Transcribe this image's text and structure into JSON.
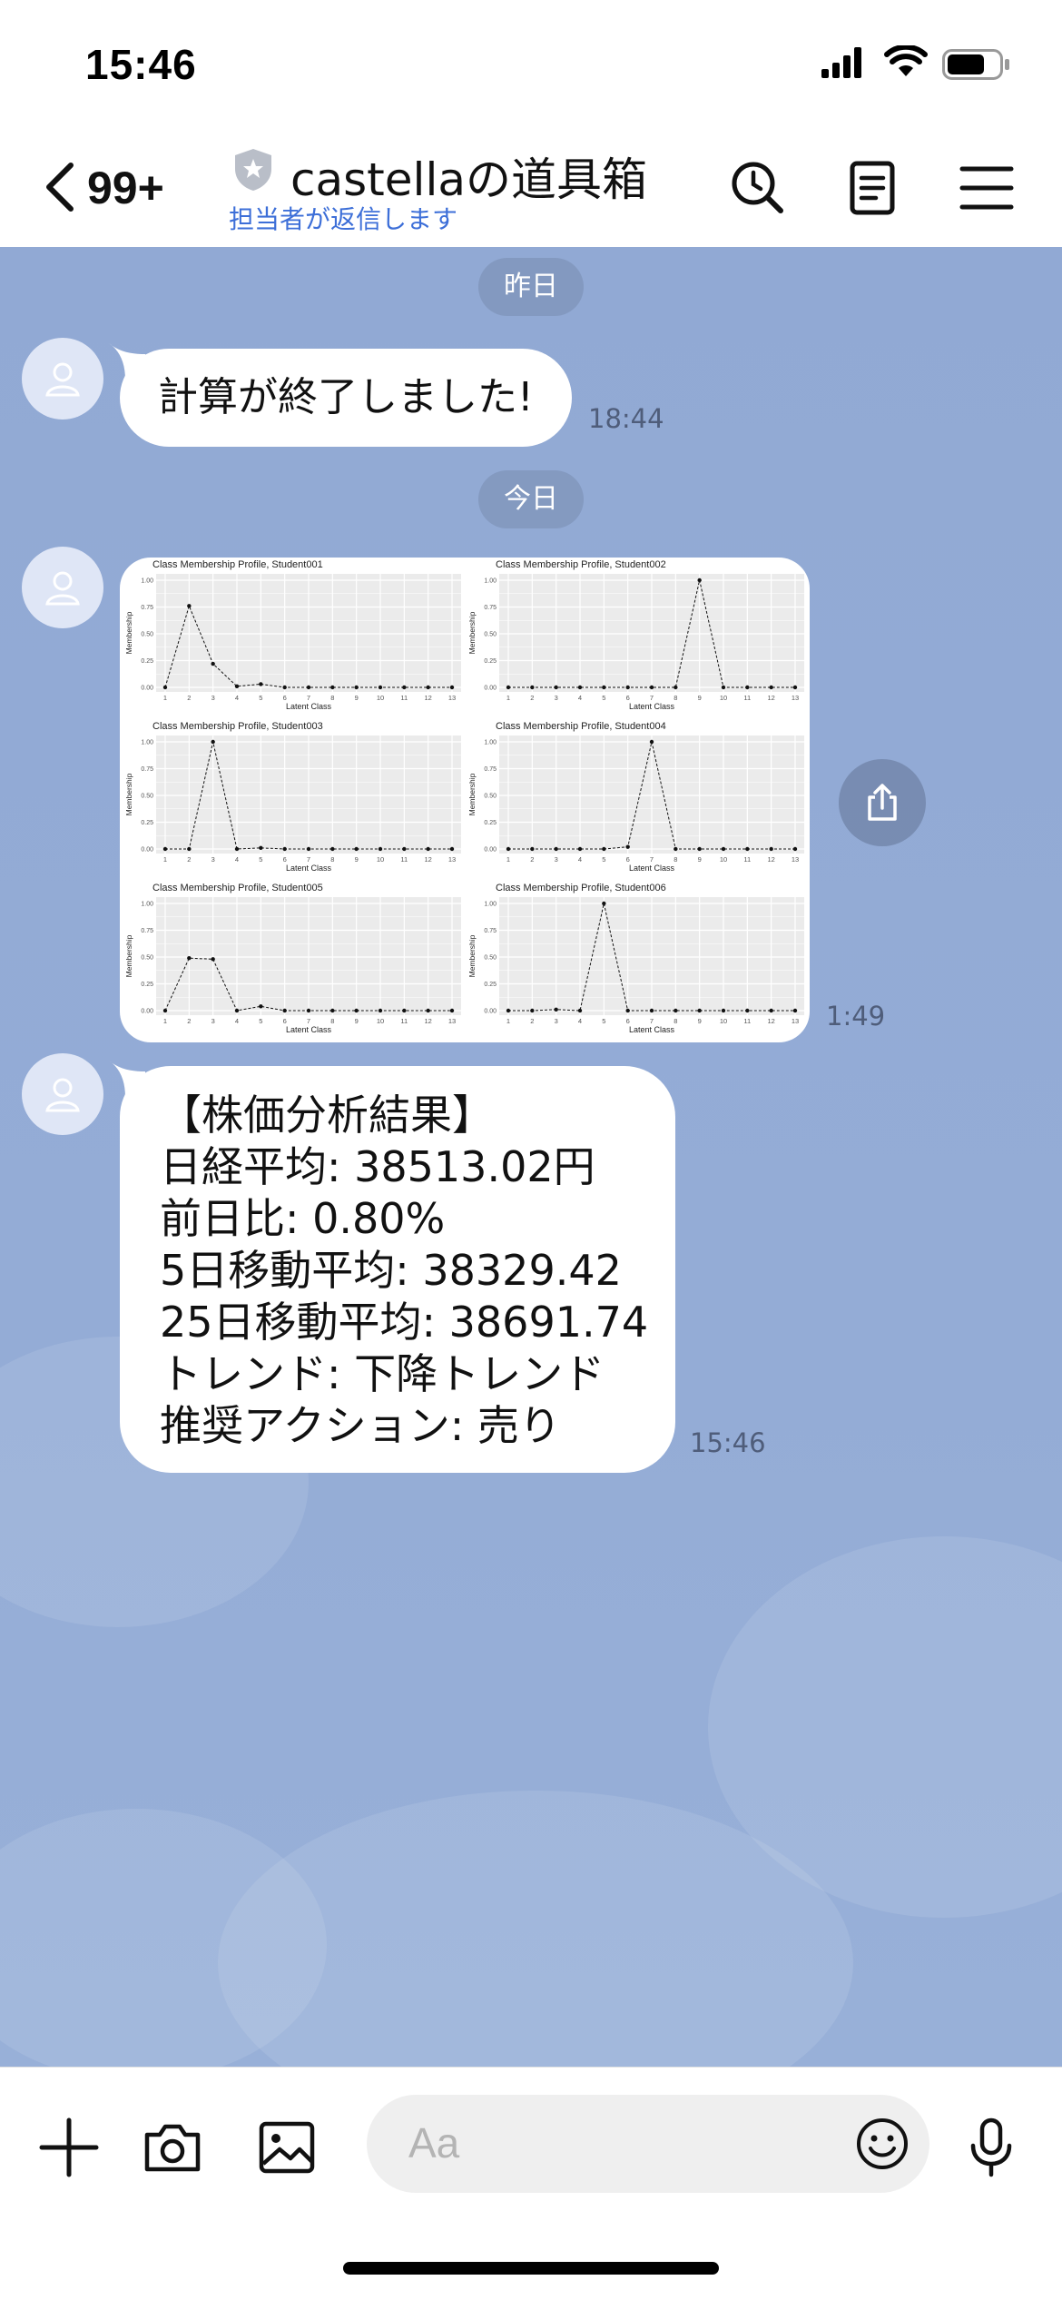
{
  "status_bar": {
    "time": "15:46"
  },
  "header": {
    "back_badge": "99+",
    "title": "castellaの道具箱",
    "subtitle": "担当者が返信します",
    "icons": [
      "search-clock-icon",
      "notes-icon",
      "menu-icon"
    ]
  },
  "chat": {
    "date_yesterday": "昨日",
    "date_today": "今日",
    "messages": [
      {
        "text": "計算が終了しました!",
        "time": "18:44"
      },
      {
        "type": "image",
        "time": "1:49",
        "chart_data": [
          {
            "type": "line",
            "title": "Class Membership Profile, Student001",
            "xlabel": "Latent Class",
            "ylabel": "Membership",
            "x": [
              1,
              2,
              3,
              4,
              5,
              6,
              7,
              8,
              9,
              10,
              11,
              12,
              13
            ],
            "values": [
              0,
              0.76,
              0.22,
              0.01,
              0.03,
              0,
              0,
              0,
              0,
              0,
              0,
              0,
              0
            ],
            "ylim": [
              0,
              1
            ],
            "yticks": [
              "0.00",
              "0.25",
              "0.50",
              "0.75",
              "1.00"
            ]
          },
          {
            "type": "line",
            "title": "Class Membership Profile, Student002",
            "xlabel": "Latent Class",
            "ylabel": "Membership",
            "x": [
              1,
              2,
              3,
              4,
              5,
              6,
              7,
              8,
              9,
              10,
              11,
              12,
              13
            ],
            "values": [
              0,
              0,
              0,
              0,
              0,
              0,
              0,
              0,
              1.0,
              0,
              0,
              0,
              0
            ],
            "ylim": [
              0,
              1
            ],
            "yticks": [
              "0.00",
              "0.25",
              "0.50",
              "0.75",
              "1.00"
            ]
          },
          {
            "type": "line",
            "title": "Class Membership Profile, Student003",
            "xlabel": "Latent Class",
            "ylabel": "Membership",
            "x": [
              1,
              2,
              3,
              4,
              5,
              6,
              7,
              8,
              9,
              10,
              11,
              12,
              13
            ],
            "values": [
              0,
              0,
              1.0,
              0,
              0.01,
              0,
              0,
              0,
              0,
              0,
              0,
              0,
              0
            ],
            "ylim": [
              0,
              1
            ],
            "yticks": [
              "0.00",
              "0.25",
              "0.50",
              "0.75",
              "1.00"
            ]
          },
          {
            "type": "line",
            "title": "Class Membership Profile, Student004",
            "xlabel": "Latent Class",
            "ylabel": "Membership",
            "x": [
              1,
              2,
              3,
              4,
              5,
              6,
              7,
              8,
              9,
              10,
              11,
              12,
              13
            ],
            "values": [
              0,
              0,
              0,
              0,
              0,
              0.02,
              1.0,
              0,
              0,
              0,
              0,
              0,
              0
            ],
            "ylim": [
              0,
              1
            ],
            "yticks": [
              "0.00",
              "0.25",
              "0.50",
              "0.75",
              "1.00"
            ]
          },
          {
            "type": "line",
            "title": "Class Membership Profile, Student005",
            "xlabel": "Latent Class",
            "ylabel": "Membership",
            "x": [
              1,
              2,
              3,
              4,
              5,
              6,
              7,
              8,
              9,
              10,
              11,
              12,
              13
            ],
            "values": [
              0,
              0.49,
              0.48,
              0,
              0.04,
              0,
              0,
              0,
              0,
              0,
              0,
              0,
              0
            ],
            "ylim": [
              0,
              1
            ],
            "yticks": [
              "0.00",
              "0.25",
              "0.50",
              "0.75",
              "1.00"
            ]
          },
          {
            "type": "line",
            "title": "Class Membership Profile, Student006",
            "xlabel": "Latent Class",
            "ylabel": "Membership",
            "x": [
              1,
              2,
              3,
              4,
              5,
              6,
              7,
              8,
              9,
              10,
              11,
              12,
              13
            ],
            "values": [
              0,
              0,
              0.01,
              0,
              1.0,
              0,
              0,
              0,
              0,
              0,
              0,
              0,
              0
            ],
            "ylim": [
              0,
              1
            ],
            "yticks": [
              "0.00",
              "0.25",
              "0.50",
              "0.75",
              "1.00"
            ]
          }
        ]
      },
      {
        "lines": [
          "【株価分析結果】",
          "日経平均: 38513.02円",
          "前日比: 0.80%",
          "5日移動平均: 38329.42",
          "25日移動平均: 38691.74",
          "トレンド: 下降トレンド",
          "推奨アクション: 売り"
        ],
        "time": "15:46"
      }
    ]
  },
  "input_bar": {
    "placeholder": "Aa",
    "icons": [
      "plus-icon",
      "camera-icon",
      "image-icon",
      "emoji-icon",
      "microphone-icon"
    ]
  }
}
